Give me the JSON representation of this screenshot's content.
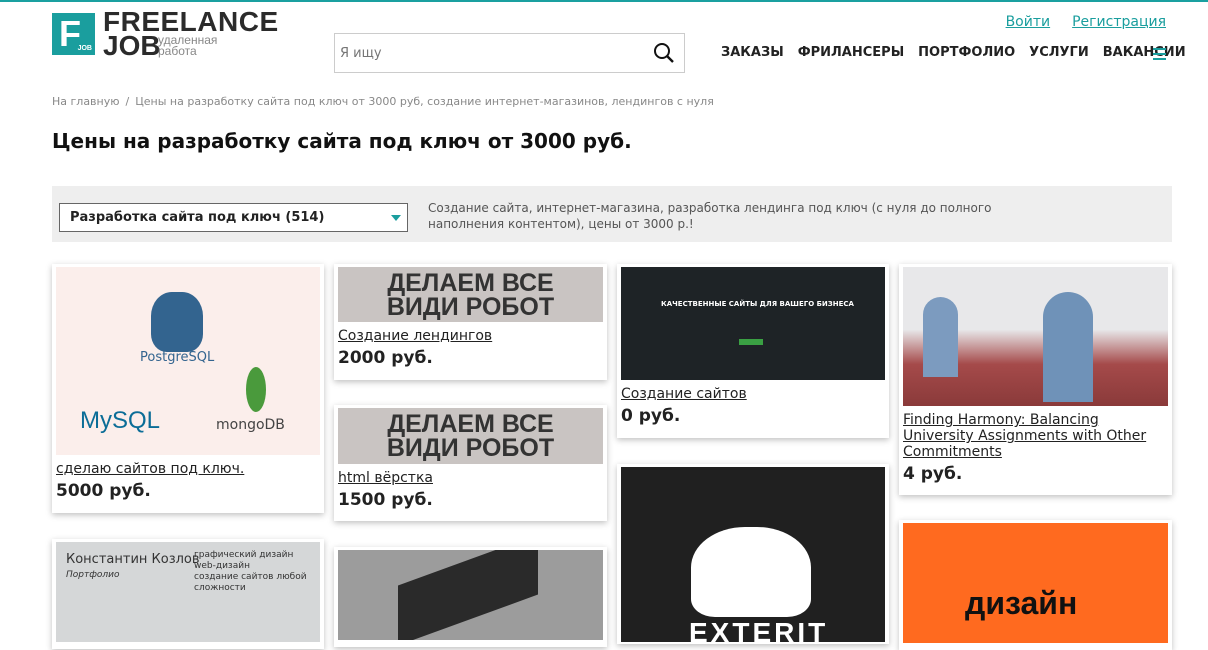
{
  "logo": {
    "letter": "F",
    "small": "JOB",
    "line1": "FREELANCE",
    "line2": "JOB",
    "tag": "удаленная работа"
  },
  "search": {
    "placeholder": "Я ищу"
  },
  "auth": {
    "login": "Войти",
    "register": "Регистрация"
  },
  "nav": [
    "ЗАКАЗЫ",
    "ФРИЛАНСЕРЫ",
    "ПОРТФОЛИО",
    "УСЛУГИ",
    "ВАКАНСИИ"
  ],
  "breadcrumb": {
    "home": "На главную",
    "sep": "/",
    "current": "Цены на разработку сайта под ключ от 3000 руб, создание интернет-магазинов, лендингов с нуля"
  },
  "title": "Цены на разработку сайта под ключ от 3000 руб.",
  "filter": {
    "selected": "Разработка сайта под ключ (514)",
    "description": "Создание сайта, интернет-магазина, разработка лендинга под ключ (с нуля до полного наполнения контентом), цены от 3000 р.!"
  },
  "cards": [
    {
      "title": "сделаю сайтов под ключ.",
      "price": "5000 руб.",
      "img": [
        "PostgreSQL",
        "MySQL",
        "mongoDB"
      ]
    },
    {
      "title": "Создание лендингов",
      "price": "2000 руб.",
      "img": [
        "ДЕЛАЕМ ВСЕ",
        "ВИДИ РОБОТ"
      ]
    },
    {
      "title": "html вёрстка",
      "price": "1500 руб.",
      "img": [
        "ДЕЛАЕМ ВСЕ",
        "ВИДИ РОБОТ"
      ]
    },
    {
      "title": "Создание сайтов",
      "price": "0 руб.",
      "img": [
        "КАЧЕСТВЕННЫЕ САЙТЫ ДЛЯ ВАШЕГО БИЗНЕСА"
      ]
    },
    {
      "title": "Finding Harmony: Balancing University Assignments with Other Commitments",
      "price": "4 руб."
    },
    {
      "img": [
        "Константин Козлов",
        "Портфолио",
        "графический дизайн",
        "web-дизайн",
        "создание сайтов любой сложности"
      ]
    },
    {
      "img": [
        "EXTERIT"
      ]
    },
    {
      "img": [
        "дизайн"
      ]
    }
  ]
}
